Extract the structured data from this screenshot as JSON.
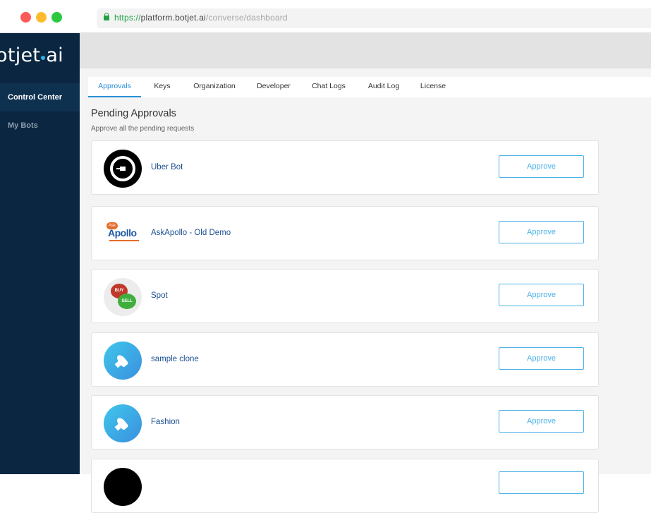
{
  "browser": {
    "url_scheme": "https://",
    "url_host": "platform.botjet.ai",
    "url_path": "/converse/dashboard"
  },
  "sidebar": {
    "logo_left": "otjet",
    "logo_right": "ai",
    "items": [
      {
        "label": "Control Center",
        "active": true
      },
      {
        "label": "My Bots",
        "active": false
      }
    ]
  },
  "tabs": [
    {
      "label": "Approvals",
      "active": true
    },
    {
      "label": "Keys"
    },
    {
      "label": "Organization"
    },
    {
      "label": "Developer"
    },
    {
      "label": "Chat Logs"
    },
    {
      "label": "Audit Log"
    },
    {
      "label": "License"
    }
  ],
  "section": {
    "title": "Pending Approvals",
    "subtitle": "Approve all the pending requests"
  },
  "approvals": [
    {
      "name": "Uber Bot",
      "icon": "uber-logo-icon",
      "action": "Approve"
    },
    {
      "name": "AskApollo - Old Demo",
      "icon": "askapollo-logo-icon",
      "icon_text_small": "Ask",
      "icon_text": "Apollo",
      "action": "Approve"
    },
    {
      "name": "Spot",
      "icon": "buy-sell-icon",
      "icon_text_buy": "BUY",
      "icon_text_sell": "SELL",
      "action": "Approve"
    },
    {
      "name": "sample clone",
      "icon": "rocket-icon",
      "action": "Approve"
    },
    {
      "name": "Fashion",
      "icon": "rocket-icon",
      "action": "Approve"
    }
  ],
  "colors": {
    "sidebar_bg": "#0b2640",
    "accent": "#2a8fd6",
    "approve_border": "#4cb1e8",
    "bot_name": "#1d4f91"
  }
}
